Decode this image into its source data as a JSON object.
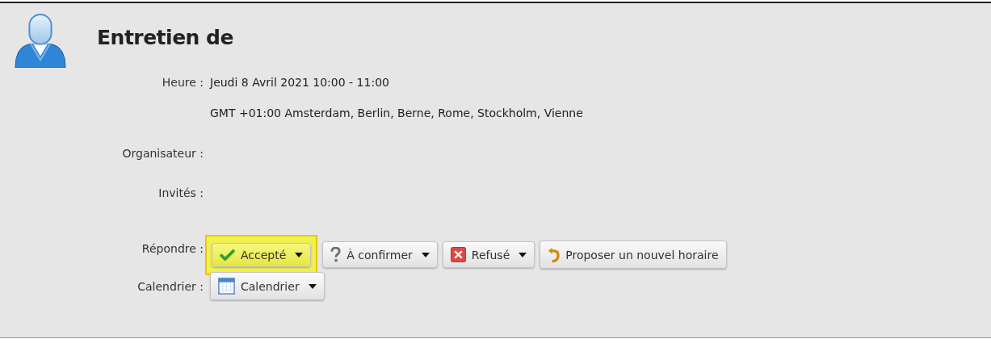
{
  "title": "Entretien de",
  "fields": [
    {
      "label": "Heure :",
      "lines": [
        "Jeudi 8 Avril 2021 10:00 - 11:00",
        "GMT +01:00 Amsterdam, Berlin, Berne, Rome, Stockholm, Vienne"
      ]
    },
    {
      "label": "Organisateur :"
    },
    {
      "label": "Invités :"
    }
  ],
  "respond": {
    "label": "Répondre :",
    "buttons": [
      {
        "kind": "accept",
        "label": "Accepté",
        "dropdown": true,
        "selected": true
      },
      {
        "kind": "tentative",
        "label": "À confirmer",
        "dropdown": true,
        "selected": false
      },
      {
        "kind": "decline",
        "label": "Refusé",
        "dropdown": true,
        "selected": false
      },
      {
        "kind": "propose",
        "label": "Proposer un nouvel horaire",
        "dropdown": false,
        "selected": false
      }
    ]
  },
  "calendar": {
    "label": "Calendrier :",
    "button": {
      "label": "Calendrier",
      "dropdown": true
    }
  }
}
